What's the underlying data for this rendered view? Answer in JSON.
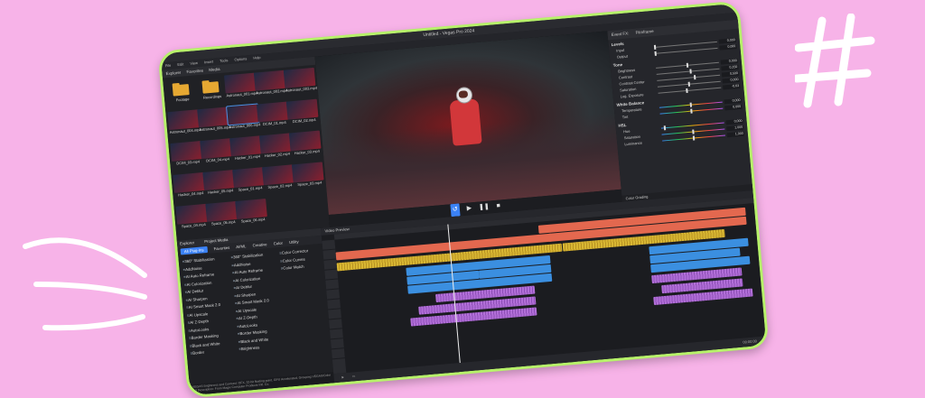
{
  "window": {
    "title": "Untitled - Vegas Pro 2024"
  },
  "menu": [
    "File",
    "Edit",
    "View",
    "Insert",
    "Tools",
    "Options",
    "Help"
  ],
  "explorer": {
    "tabs": [
      "Explorer",
      "Favorites",
      "Media"
    ],
    "items": [
      {
        "name": "Footage",
        "kind": "folder"
      },
      {
        "name": "Recordings",
        "kind": "folder"
      },
      {
        "name": "Astronaut_001.mp4",
        "kind": "video"
      },
      {
        "name": "Astronaut_002.mp4",
        "kind": "video"
      },
      {
        "name": "Astronaut_003.mp4",
        "kind": "video"
      },
      {
        "name": "Astronaut_004.mp4",
        "kind": "video"
      },
      {
        "name": "Astronaut_005.mp4",
        "kind": "video"
      },
      {
        "name": "Astronaut_006.mp4",
        "kind": "video"
      },
      {
        "name": "DCIM_01.mp4",
        "kind": "video"
      },
      {
        "name": "DCIM_02.mp4",
        "kind": "video"
      },
      {
        "name": "DCIM_03.mp4",
        "kind": "video"
      },
      {
        "name": "DCIM_04.mp4",
        "kind": "video"
      },
      {
        "name": "Hacker_01.mp4",
        "kind": "video"
      },
      {
        "name": "Hacker_02.mp4",
        "kind": "video"
      },
      {
        "name": "Hacker_03.mp4",
        "kind": "video"
      },
      {
        "name": "Hacker_04.mp4",
        "kind": "video"
      },
      {
        "name": "Hacker_05.mp4",
        "kind": "video"
      },
      {
        "name": "Space_01.mp4",
        "kind": "video"
      },
      {
        "name": "Space_02.mp4",
        "kind": "video"
      },
      {
        "name": "Space_03.mp4",
        "kind": "video"
      },
      {
        "name": "Space_04.mp4",
        "kind": "video"
      },
      {
        "name": "Space_05.mp4",
        "kind": "video"
      },
      {
        "name": "Space_06.mp4",
        "kind": "video"
      }
    ]
  },
  "grading": {
    "title": "Event FX:",
    "preset": "Filmframe",
    "sections": [
      {
        "name": "Levels",
        "rows": [
          {
            "label": "Input",
            "value": "0,000",
            "level": 0.0
          },
          {
            "label": "Output",
            "value": "0,000",
            "level": 0.0
          }
        ]
      },
      {
        "name": "Tone",
        "rows": [
          {
            "label": "Brightness",
            "value": "0,000",
            "level": 0.5
          },
          {
            "label": "Contrast",
            "value": "0,250",
            "level": 0.55
          },
          {
            "label": "Contrast Center",
            "value": "0,500",
            "level": 0.6
          },
          {
            "label": "Saturation",
            "value": "0,000",
            "level": 0.5
          },
          {
            "label": "Log. Exposure",
            "value": "-0,63",
            "level": 0.45
          }
        ]
      },
      {
        "name": "White Balance",
        "rows": [
          {
            "label": "Temperature",
            "value": "0,000",
            "level": 0.5
          },
          {
            "label": "Tint",
            "value": "0,000",
            "level": 0.5
          }
        ]
      },
      {
        "name": "HSL",
        "rows": [
          {
            "label": "Hue",
            "value": "0,000",
            "level": 0.05
          },
          {
            "label": "Saturation",
            "value": "1,000",
            "level": 0.5
          },
          {
            "label": "Luminance",
            "value": "1,000",
            "level": 0.5
          }
        ]
      }
    ],
    "footer": "Color Grading"
  },
  "fx": {
    "tabs": [
      "Explorer",
      "Project Media"
    ],
    "filters": [
      "All Plug-Ins",
      "Favorites",
      "AI/ML",
      "Creative",
      "Color",
      "Utility"
    ],
    "col1": [
      "360° Stabilization",
      "AddNoise",
      "AI Auto Reframe",
      "AI Colorization",
      "AI Deblur",
      "AI Sharpen",
      "AI Smart Mask 2.0",
      "AI Upscale",
      "AI Z-Depth",
      "AutoLooks",
      "Border Masking",
      "Black and White",
      "Border"
    ],
    "col2": [
      "360° Stabilization",
      "AddNoise",
      "AI Auto Reframe",
      "AI Colorization",
      "AI Deblur",
      "AI Sharpen",
      "AI Smart Mask 2.0",
      "AI Upscale",
      "AI Z-Depth",
      "AutoLooks",
      "Border Masking",
      "Black and White",
      "Brightness"
    ],
    "col3": [
      "Color Corrector",
      "Color Curves",
      "Color Match"
    ],
    "status": "VEGAS Brightness and Contrast: OFX, 32-bit floating point, GPU Accelerated, Grouping VEGAS\\Color 3.0 Description: From Magix Computer Products Intl. Co."
  },
  "timeline": {
    "header": "Video Preview",
    "footer_time": "00:00:00"
  }
}
